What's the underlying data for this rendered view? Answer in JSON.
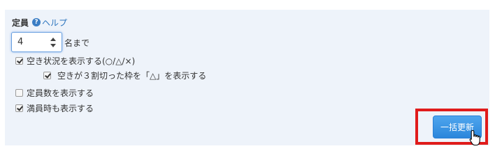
{
  "capacity": {
    "label": "定員",
    "help_icon_glyph": "?",
    "help_link": "ヘルプ",
    "value": "4",
    "unit": "名まで"
  },
  "options": {
    "show_availability": {
      "label": "空き状況を表示する(○/△/×)",
      "checked": true
    },
    "show_triangle": {
      "label": "空きが３割切った枠を「△」を表示する",
      "checked": true
    },
    "show_capacity_count": {
      "label": "定員数を表示する",
      "checked": false
    },
    "show_when_full": {
      "label": "満員時も表示する",
      "checked": true
    }
  },
  "actions": {
    "bulk_update_label": "一括更新"
  },
  "colors": {
    "panel_bg": "#eef3fa",
    "link": "#2a73bd",
    "button": "#2b86db",
    "highlight": "#e01b1b"
  },
  "icons": {
    "help": "question-circle-icon",
    "cursor": "hand-pointer-icon"
  }
}
